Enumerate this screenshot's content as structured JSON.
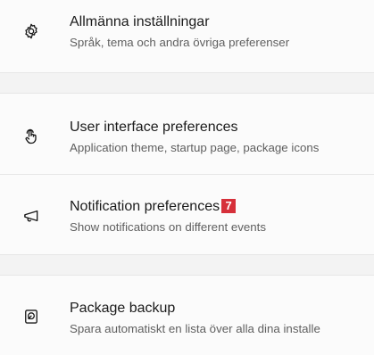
{
  "settings": {
    "general": {
      "icon": "gear-icon",
      "title": "Allmänna inställningar",
      "subtitle": "Språk, tema och andra övriga preferenser"
    },
    "ui": {
      "icon": "touch-pointer-icon",
      "title": "User interface preferences",
      "subtitle": "Application theme, startup page, package icons"
    },
    "notifications": {
      "icon": "megaphone-icon",
      "title": "Notification preferences",
      "badge": "7",
      "subtitle": "Show notifications on different events"
    },
    "backup": {
      "icon": "backup-disk-icon",
      "title": "Package backup",
      "subtitle": "Spara automatiskt en lista över alla dina installe"
    }
  },
  "colors": {
    "background": "#f3f3f3",
    "card": "#fbfbfb",
    "badge": "#d6303a"
  }
}
